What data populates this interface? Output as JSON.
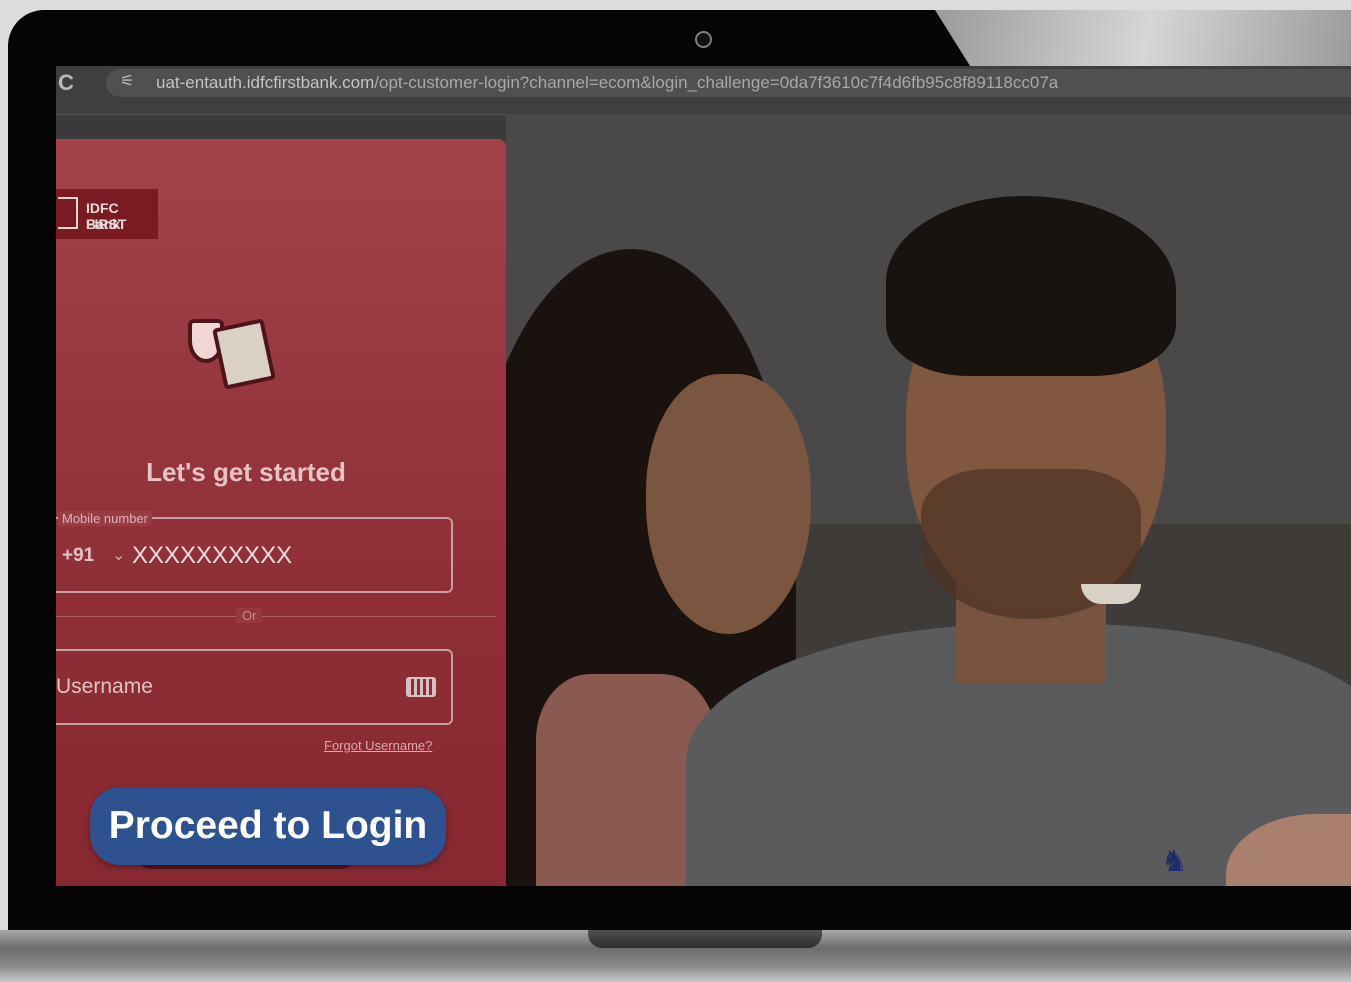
{
  "browser": {
    "url_domain": "uat-entauth.idfcfirstbank.com",
    "url_path": "/opt-customer-login?channel=ecom&login_challenge=0da7f3610c7f4d6fb95c8f89118cc07a"
  },
  "login_card": {
    "brand_line1": "IDFC FIRST",
    "brand_line2": "Bank",
    "heading": "Let's get started",
    "mobile_label": "Mobile number",
    "country_code": "+91",
    "mobile_value": "XXXXXXXXXX",
    "or_text": "Or",
    "username_placeholder": "Username",
    "forgot_username": "Forgot Username?"
  },
  "cta": {
    "label": "Proceed to Login"
  },
  "colors": {
    "card_bg": "#8e2e36",
    "cta_bg": "#2e528f"
  }
}
